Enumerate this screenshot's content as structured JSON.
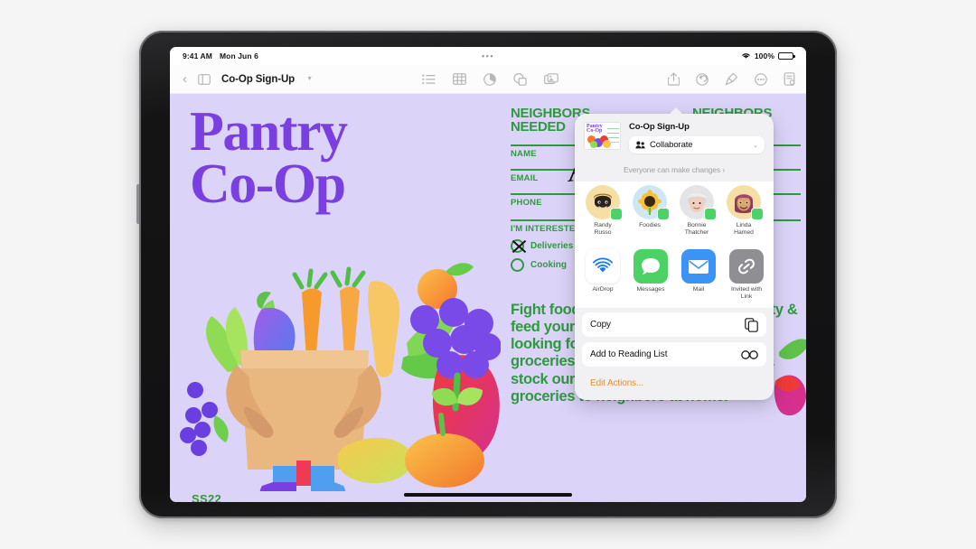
{
  "status_bar": {
    "time": "9:41 AM",
    "date": "Mon Jun 6",
    "center_dots": "•••",
    "battery_percent": "100%",
    "wifi_icon": "wifi-icon",
    "battery_icon": "battery-full-icon"
  },
  "toolbar": {
    "back_icon": "chevron-left-icon",
    "sidebar_icon": "sidebar-toggle-icon",
    "document_title": "Co-Op Sign-Up",
    "title_chevron_icon": "chevron-down-icon",
    "center_icons": [
      "list-icon",
      "table-icon",
      "chart-icon",
      "shapes-icon",
      "media-icon"
    ],
    "right_icons": [
      "share-icon",
      "undo-icon",
      "format-brush-icon",
      "more-ellipsis-icon",
      "document-options-icon"
    ]
  },
  "document": {
    "poster_title": "Pantry\nCo-Op",
    "season_label": "SS22",
    "accent_purple": "#7a3fe0",
    "accent_green": "#2e9a3e",
    "canvas_bg": "#dcd4f8",
    "form": {
      "heading": "NEIGHBORS\nNEEDED",
      "fields": [
        {
          "label": "NAME",
          "value": "Ag"
        },
        {
          "label": "EMAIL",
          "value": ""
        },
        {
          "label": "PHONE",
          "value": ""
        }
      ],
      "signature_text": "Ag",
      "interest_heading": "I'M INTERESTED IN",
      "interest_options": [
        {
          "label": "Deliveries",
          "checked": true
        },
        {
          "label": "Cooking",
          "checked": false
        }
      ]
    },
    "body_copy": "Fight food insecurity in your community & feed your neighbors. Pantry Co-Op is looking for people like you to shop for groceries & essential supplies, clean & stock our community fridge, & deliver groceries to neighbors at home."
  },
  "share_sheet": {
    "thumbnail_title": "Pantry\nCo-Op",
    "document_name": "Co-Op Sign-Up",
    "collaborate_label": "Collaborate",
    "collaborate_icon": "people-icon",
    "collaborate_chevron_icon": "chevron-updown-icon",
    "permission_text": "Everyone can make changes ›",
    "contacts": [
      {
        "name": "Randy\nRusso",
        "avatar": "memoji-randy",
        "bg": "#f6dfa4",
        "glyph": "🧑🏿"
      },
      {
        "name": "Foodies",
        "avatar": "sunflower-group",
        "bg": "#cfe7f5",
        "glyph": "🌻"
      },
      {
        "name": "Bonnie\nThatcher",
        "avatar": "memoji-bonnie",
        "bg": "#e4e4e6",
        "glyph": "👵🏻"
      },
      {
        "name": "Linda\nHamed",
        "avatar": "memoji-linda",
        "bg": "#f6dfa4",
        "glyph": "🧕"
      }
    ],
    "apps": [
      {
        "label": "AirDrop",
        "icon": "airdrop-icon",
        "bg": "#ffffff"
      },
      {
        "label": "Messages",
        "icon": "messages-icon",
        "bg": "#4cd264"
      },
      {
        "label": "Mail",
        "icon": "mail-icon",
        "bg": "#3b93f5"
      },
      {
        "label": "Invited with\nLink",
        "icon": "link-icon",
        "bg": "#8e8e93"
      }
    ],
    "actions": [
      {
        "label": "Copy",
        "icon": "copy-icon"
      },
      {
        "label": "Add to Reading List",
        "icon": "glasses-icon"
      }
    ],
    "edit_actions_label": "Edit Actions...",
    "edit_actions_color": "#e0923a"
  }
}
